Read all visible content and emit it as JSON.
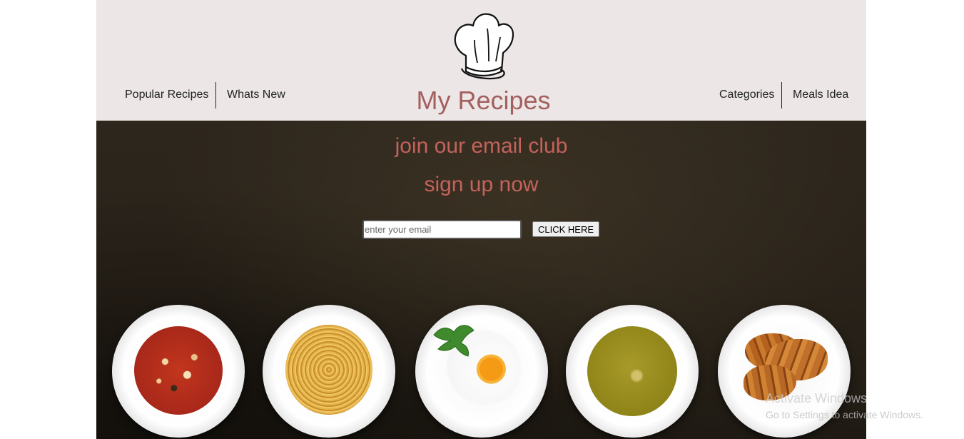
{
  "header": {
    "title": "My Recipes",
    "nav_left": [
      "Popular Recipes",
      "Whats New"
    ],
    "nav_right": [
      "Categories",
      "Meals Idea"
    ],
    "logo_icon": "chef-hat-icon"
  },
  "hero": {
    "heading": "join our email club",
    "subheading": "sign up now",
    "email_placeholder": "enter your email",
    "email_value": "",
    "button_label": "CLICK HERE"
  },
  "plates": [
    {
      "name": "minestrone-soup-plate",
      "icon": "soup-icon"
    },
    {
      "name": "spaghetti-plate",
      "icon": "pasta-icon"
    },
    {
      "name": "fried-egg-plate",
      "icon": "egg-icon"
    },
    {
      "name": "pea-soup-plate",
      "icon": "soup-icon"
    },
    {
      "name": "croissant-plate",
      "icon": "croissant-icon"
    }
  ],
  "watermark": {
    "title": "Activate Windows",
    "subtitle": "Go to Settings to activate Windows."
  },
  "colors": {
    "header_bg": "#ece6e6",
    "title": "#a45f5f",
    "hero_text": "#c4625c",
    "hero_bg": "#2a231a"
  }
}
